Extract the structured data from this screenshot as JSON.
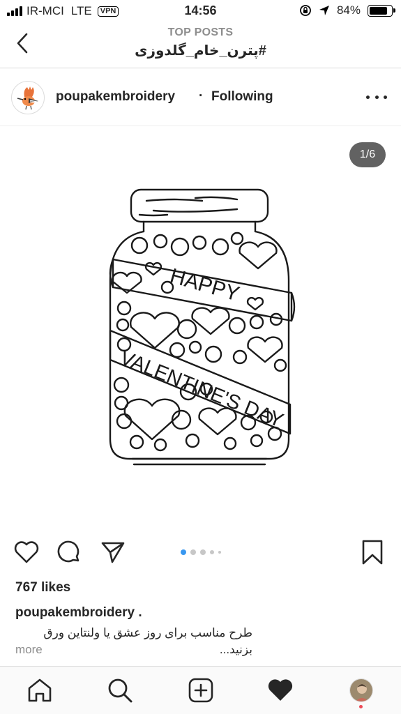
{
  "status_bar": {
    "carrier": "IR-MCI",
    "network": "LTE",
    "vpn": "VPN",
    "time": "14:56",
    "battery": "84%",
    "battery_level": 0.84
  },
  "nav": {
    "subtitle": "TOP POSTS",
    "title": "#پترن_خام_گلدوزی"
  },
  "post": {
    "username": "poupakembroidery",
    "separator": "·",
    "follow_status": "Following",
    "counter": "1/6",
    "image_text": {
      "line1": "HAPPY",
      "line2": "VALENTINE'S DAY"
    },
    "carousel_active_index": 0,
    "likes": "767 likes",
    "caption_user": "poupakembroidery .",
    "caption": "طرح مناسب برای روز عشق یا ولنتاین ورق بزنید...",
    "more": "more"
  },
  "icons": {
    "back": "chevron-left-icon",
    "more": "more-horizontal-icon",
    "like": "heart-outline-icon",
    "comment": "comment-icon",
    "share": "paper-plane-icon",
    "save": "bookmark-icon",
    "home": "home-icon",
    "search": "search-icon",
    "new_post": "plus-square-icon",
    "activity": "heart-filled-icon"
  },
  "colors": {
    "accent": "#3897f0",
    "text": "#262626",
    "muted": "#8e8e8e",
    "notification": "#ed4956"
  }
}
